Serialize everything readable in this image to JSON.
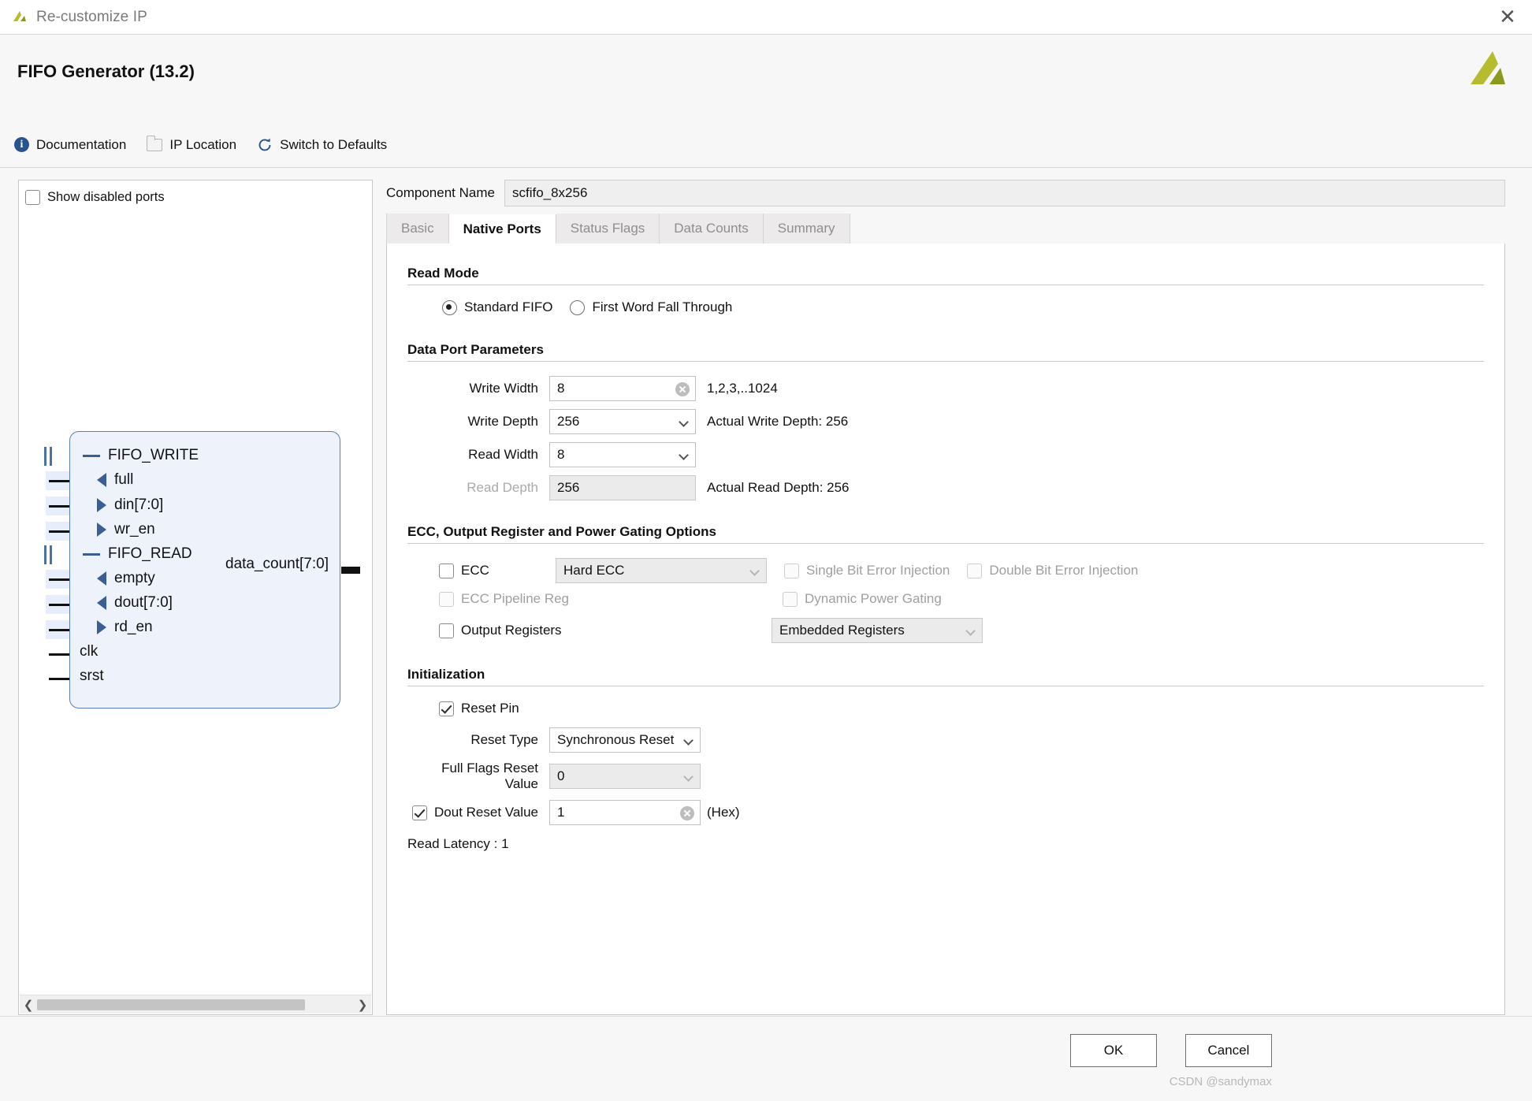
{
  "window": {
    "title": "Re-customize IP",
    "close_icon": "close-icon",
    "app_icon": "xilinx-logo-icon"
  },
  "header": {
    "title": "FIFO Generator (13.2)",
    "logo_icon": "xilinx-logo-icon"
  },
  "toolbar": {
    "items": [
      {
        "label": "Documentation",
        "icon": "info-icon"
      },
      {
        "label": "IP Location",
        "icon": "folder-icon"
      },
      {
        "label": "Switch to Defaults",
        "icon": "refresh-icon"
      }
    ]
  },
  "diagram": {
    "show_disabled_ports_label": "Show disabled ports",
    "show_disabled_ports_checked": false,
    "ports": [
      {
        "name": "FIFO_WRITE",
        "kind": "bus-group"
      },
      {
        "name": "full",
        "kind": "output"
      },
      {
        "name": "din[7:0]",
        "kind": "input"
      },
      {
        "name": "wr_en",
        "kind": "input"
      },
      {
        "name": "FIFO_READ",
        "kind": "bus-group"
      },
      {
        "name": "empty",
        "kind": "output"
      },
      {
        "name": "dout[7:0]",
        "kind": "output"
      },
      {
        "name": "rd_en",
        "kind": "input"
      },
      {
        "name": "clk",
        "kind": "plain"
      },
      {
        "name": "srst",
        "kind": "plain"
      }
    ],
    "right_port": "data_count[7:0]",
    "scroll_left_icon": "chevron-left-icon",
    "scroll_right_icon": "chevron-right-icon"
  },
  "component": {
    "label": "Component Name",
    "value": "scfifo_8x256"
  },
  "tabs": [
    {
      "label": "Basic",
      "active": false
    },
    {
      "label": "Native Ports",
      "active": true
    },
    {
      "label": "Status Flags",
      "active": false
    },
    {
      "label": "Data Counts",
      "active": false
    },
    {
      "label": "Summary",
      "active": false
    }
  ],
  "read_mode": {
    "title": "Read Mode",
    "options": [
      {
        "label": "Standard FIFO",
        "selected": true
      },
      {
        "label": "First Word Fall Through",
        "selected": false
      }
    ]
  },
  "data_port_parameters": {
    "title": "Data Port Parameters",
    "write_width": {
      "label": "Write Width",
      "value": "8",
      "hint": "1,2,3,..1024"
    },
    "write_depth": {
      "label": "Write Depth",
      "value": "256",
      "hint": "Actual Write Depth: 256"
    },
    "read_width": {
      "label": "Read Width",
      "value": "8",
      "hint": ""
    },
    "read_depth": {
      "label": "Read Depth",
      "value": "256",
      "hint": "Actual Read Depth: 256"
    }
  },
  "ecc_section": {
    "title": "ECC, Output Register and Power Gating Options",
    "ecc": {
      "label": "ECC",
      "checked": false
    },
    "ecc_mode": {
      "value": "Hard ECC"
    },
    "single_bit_error_injection": {
      "label": "Single Bit Error Injection",
      "checked": false
    },
    "double_bit_error_injection": {
      "label": "Double Bit Error Injection",
      "checked": false
    },
    "ecc_pipeline_reg": {
      "label": "ECC Pipeline Reg",
      "checked": false
    },
    "dynamic_power_gating": {
      "label": "Dynamic Power Gating",
      "checked": false
    },
    "output_registers": {
      "label": "Output Registers",
      "checked": false
    },
    "output_registers_mode": {
      "value": "Embedded Registers"
    }
  },
  "initialization": {
    "title": "Initialization",
    "reset_pin": {
      "label": "Reset Pin",
      "checked": true
    },
    "reset_type": {
      "label": "Reset Type",
      "value": "Synchronous Reset"
    },
    "full_flags_reset_value": {
      "label": "Full Flags Reset Value",
      "value": "0"
    },
    "dout_reset_value": {
      "label": "Dout Reset Value",
      "value": "1",
      "checked": true,
      "suffix": "(Hex)"
    },
    "read_latency": "Read Latency : 1"
  },
  "footer": {
    "ok_label": "OK",
    "cancel_label": "Cancel",
    "watermark": "CSDN @sandymax"
  }
}
